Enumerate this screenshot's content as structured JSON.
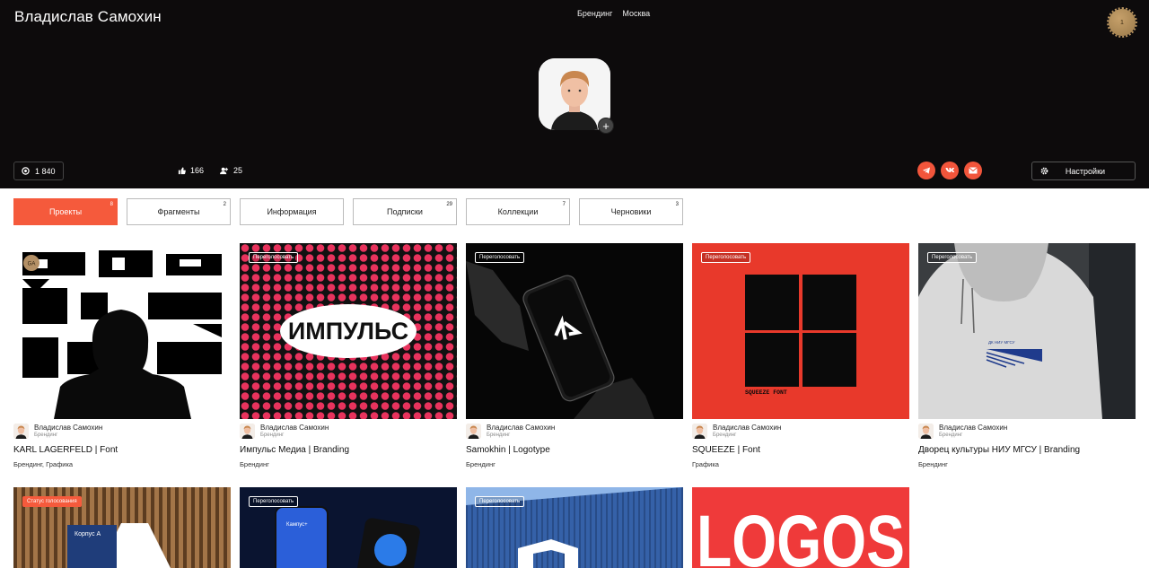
{
  "header": {
    "name": "Владислав Самохин",
    "tags": [
      "Брендинг",
      "Москва"
    ],
    "seal_text": "1",
    "views": "1 840",
    "likes": "166",
    "followers": "25",
    "settings_label": "Настройки"
  },
  "tabs": [
    {
      "label": "Проекты",
      "count": "8"
    },
    {
      "label": "Фрагменты",
      "count": "2"
    },
    {
      "label": "Информация",
      "count": ""
    },
    {
      "label": "Подписки",
      "count": "29"
    },
    {
      "label": "Коллекции",
      "count": "7"
    },
    {
      "label": "Черновики",
      "count": "3"
    }
  ],
  "author": {
    "name": "Владислав Самохин",
    "role": "Брендинг"
  },
  "vote_label": "Переголосовать",
  "status_label": "Статус голосования",
  "badge_label": "GA",
  "projects": [
    {
      "title": "KARL LAGERFELD | Font",
      "category": "Брендинг, Графика"
    },
    {
      "title": "Импульс Медиа | Branding",
      "category": "Брендинг"
    },
    {
      "title": "Samokhin | Logotype",
      "category": "Брендинг"
    },
    {
      "title": "SQUEEZE | Font",
      "category": "Графика"
    },
    {
      "title": "Дворец культуры НИУ МГСУ | Branding",
      "category": "Брендинг"
    }
  ],
  "artwork_text": {
    "impuls": "ИМПУЛЬС",
    "squeeze": "SQUEEZE FONT",
    "hoodie": "ДК НИУ МГСУ",
    "korpus": "Корпус А",
    "phone_app": "Кампус+",
    "logos": "LOGOS"
  },
  "colors": {
    "accent": "#f55a3c",
    "header_bg": "#0d0b0c"
  }
}
